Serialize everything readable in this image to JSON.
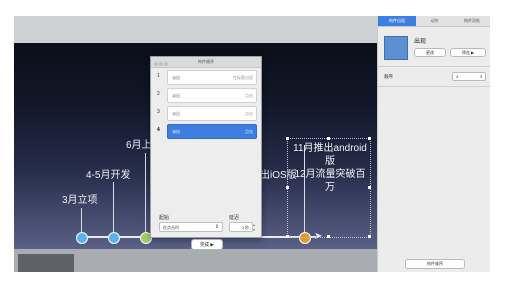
{
  "slide": {
    "timeline": [
      {
        "label": "3月立项",
        "color": "#55b5e8"
      },
      {
        "label": "4-5月开发",
        "color": "#55b5e8"
      },
      {
        "label": "6月上线",
        "color": "#9ed06a"
      },
      {
        "label": "出iOS版",
        "color": "#e39a2a"
      }
    ],
    "selected_text_line1": "11月推出android版",
    "selected_text_line2": "12月流量突破百万"
  },
  "dialog": {
    "title": "构件顺序",
    "rows": [
      {
        "num": "1",
        "name": "淡出",
        "detail": "在标题出现"
      },
      {
        "num": "2",
        "name": "淡出",
        "detail": "点击"
      },
      {
        "num": "3",
        "name": "淡出",
        "detail": "点击"
      },
      {
        "num": "4",
        "name": "淡出",
        "detail": "点击"
      }
    ],
    "order_label": "起始",
    "delay_label": "延迟",
    "order_value": "在点击时",
    "delay_value": "0 秒",
    "ok_label": "完成"
  },
  "inspector": {
    "tabs": [
      "构件出现",
      "动作",
      "构件消失"
    ],
    "title": "出现",
    "change_button": "更改",
    "preview_button": "预览",
    "order_label": "顺序",
    "order_value": "4",
    "build_order_button": "构件顺序"
  }
}
